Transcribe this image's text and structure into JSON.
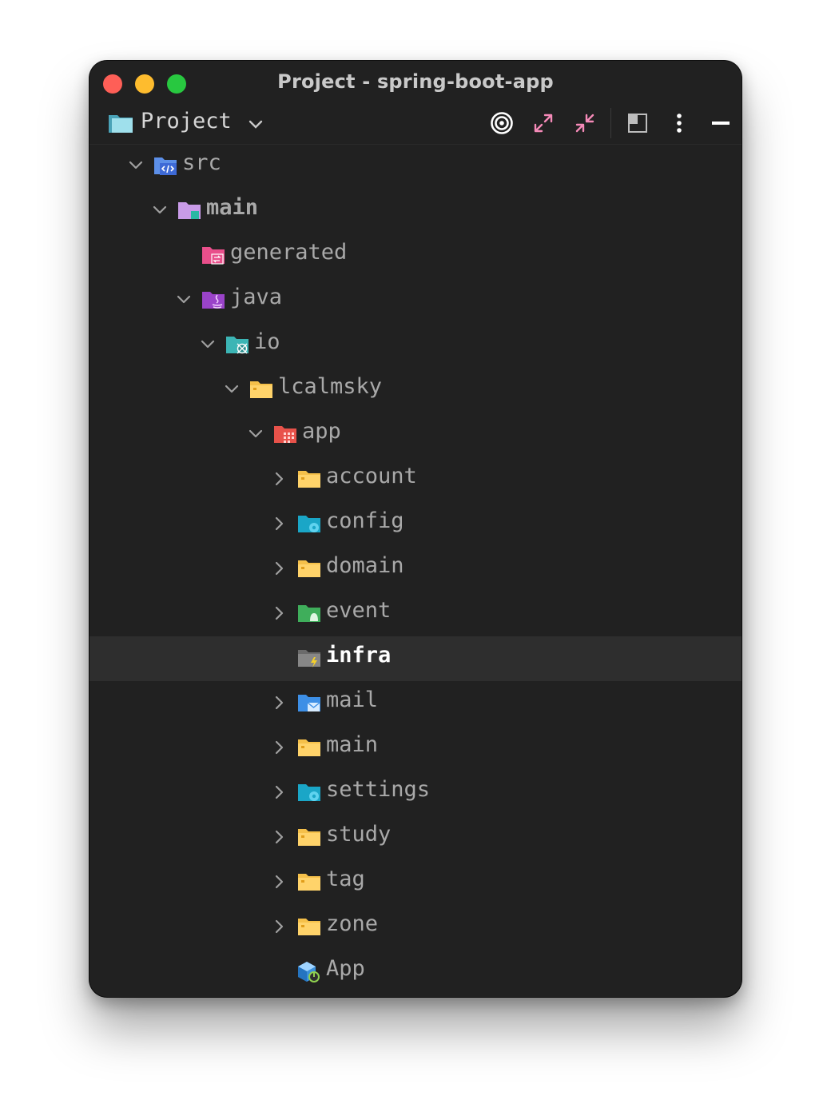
{
  "window": {
    "title": "Project - spring-boot-app"
  },
  "toolbar": {
    "view_label": "Project",
    "buttons": [
      "target-icon",
      "expand-icon",
      "collapse-icon",
      "layout-icon",
      "more-icon",
      "minimize-icon"
    ]
  },
  "colors": {
    "background": "#212121",
    "selected_row": "#2e2e2e",
    "text": "#a9a9a9",
    "folder_yellow": "#f5c04a",
    "accent_pink": "#e94f8b"
  },
  "tree": [
    {
      "label": "src",
      "depth": 0,
      "expanded": true,
      "icon": "source-folder-icon",
      "bold": false
    },
    {
      "label": "main",
      "depth": 1,
      "expanded": true,
      "icon": "module-folder-icon",
      "bold": true
    },
    {
      "label": "generated",
      "depth": 2,
      "expanded": null,
      "icon": "generated-folder-icon",
      "bold": false
    },
    {
      "label": "java",
      "depth": 2,
      "expanded": true,
      "icon": "java-folder-icon",
      "bold": false
    },
    {
      "label": "io",
      "depth": 3,
      "expanded": true,
      "icon": "package-folder-icon",
      "bold": false
    },
    {
      "label": "lcalmsky",
      "depth": 4,
      "expanded": true,
      "icon": "folder-icon",
      "bold": false
    },
    {
      "label": "app",
      "depth": 5,
      "expanded": true,
      "icon": "app-folder-icon",
      "bold": false
    },
    {
      "label": "account",
      "depth": 6,
      "expanded": false,
      "icon": "folder-icon",
      "bold": false
    },
    {
      "label": "config",
      "depth": 6,
      "expanded": false,
      "icon": "config-folder-icon",
      "bold": false
    },
    {
      "label": "domain",
      "depth": 6,
      "expanded": false,
      "icon": "folder-icon",
      "bold": false
    },
    {
      "label": "event",
      "depth": 6,
      "expanded": false,
      "icon": "event-folder-icon",
      "bold": false
    },
    {
      "label": "infra",
      "depth": 6,
      "expanded": null,
      "icon": "infra-folder-icon",
      "bold": false,
      "selected": true
    },
    {
      "label": "mail",
      "depth": 6,
      "expanded": false,
      "icon": "mail-folder-icon",
      "bold": false
    },
    {
      "label": "main",
      "depth": 6,
      "expanded": false,
      "icon": "folder-icon",
      "bold": false
    },
    {
      "label": "settings",
      "depth": 6,
      "expanded": false,
      "icon": "config-folder-icon",
      "bold": false
    },
    {
      "label": "study",
      "depth": 6,
      "expanded": false,
      "icon": "folder-icon",
      "bold": false
    },
    {
      "label": "tag",
      "depth": 6,
      "expanded": false,
      "icon": "folder-icon",
      "bold": false
    },
    {
      "label": "zone",
      "depth": 6,
      "expanded": false,
      "icon": "folder-icon",
      "bold": false
    },
    {
      "label": "App",
      "depth": 6,
      "expanded": null,
      "icon": "spring-boot-class-icon",
      "bold": false
    }
  ]
}
